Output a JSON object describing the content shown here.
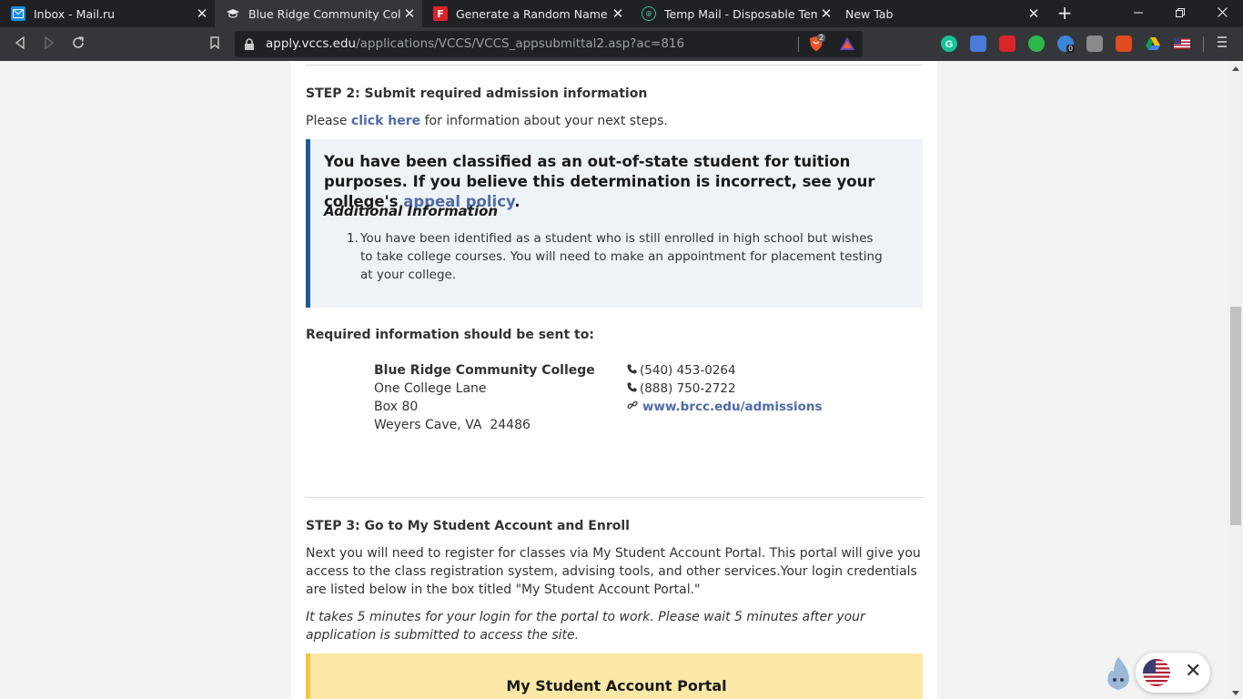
{
  "browser": {
    "tabs": [
      {
        "title": "Inbox - Mail.ru",
        "icon": "mail-icon",
        "active": false
      },
      {
        "title": "Blue Ridge Community College -",
        "icon": "graduation-cap-icon",
        "active": true
      },
      {
        "title": "Generate a Random Name - Mal",
        "icon": "f-logo-icon",
        "active": false
      },
      {
        "title": "Temp Mail - Disposable Tempora",
        "icon": "temp-mail-icon",
        "active": false
      },
      {
        "title": "New Tab",
        "icon": "",
        "active": false
      }
    ],
    "new_tab_glyph": "+",
    "close_glyph": "✕",
    "url_domain": "apply.vccs.edu",
    "url_path": "/applications/VCCS/VCCS_appsubmittal2.asp?ac=816",
    "brave_badge": "2",
    "ext_badge": "0"
  },
  "step2": {
    "heading": "STEP 2: Submit required admission information",
    "intro_pre": "Please ",
    "intro_link": "click here",
    "intro_post": " for information about your next steps.",
    "notice_text": "You have been classified as an out-of-state student for tuition purposes. If you believe this determination is incorrect, see your college's ",
    "notice_link": "appeal policy",
    "notice_end": ".",
    "additional_heading": "Additional Information",
    "item_number": "1.",
    "item_text": "You have been identified as a student who is still enrolled in high school but wishes to take college courses. You will need to make an appointment for placement testing at your college.",
    "sent_to_label": "Required information should be sent to:",
    "college_name": "Blue Ridge Community College",
    "address_line1": "One College Lane",
    "address_line2": "Box 80",
    "address_line3": "Weyers Cave, VA  24486",
    "phone1": "(540) 453-0264",
    "phone2": "(888) 750-2722",
    "website": "www.brcc.edu/admissions"
  },
  "step3": {
    "heading": "STEP 3: Go to My Student Account and Enroll",
    "body": "Next you will need to register for classes via My Student Account Portal. This portal will give you access to the class registration system, advising tools, and other services.Your login credentials are listed below in the box titled \"My Student Account Portal.\"",
    "note": "It takes 5 minutes for your login for the portal to work. Please wait 5 minutes after your application is submitted to access the site.",
    "portal_heading": "My Student Account Portal"
  },
  "widget": {
    "close_glyph": "✕"
  },
  "colors": {
    "link": "#4f6ba8",
    "notice_border": "#1d5b96",
    "notice_bg": "#eef3f8",
    "portal_bg": "#fbe8a6",
    "portal_border": "#f0c83c"
  }
}
